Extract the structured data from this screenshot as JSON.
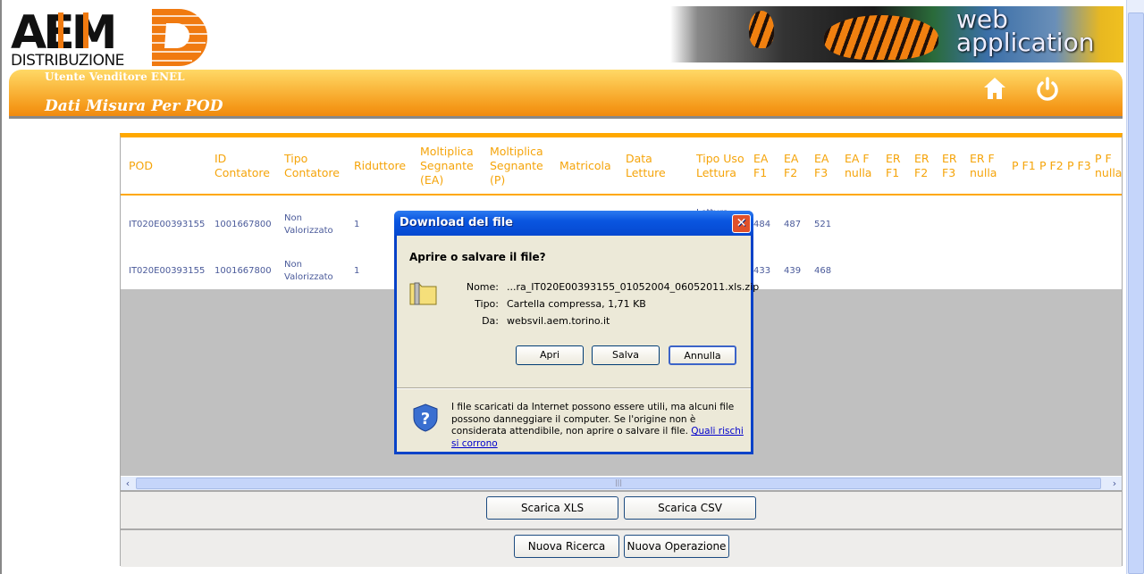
{
  "header": {
    "logo_text": "AEM DISTRIBUZIONE",
    "banner_text_1": "web",
    "banner_text_2": "application",
    "user": "Utente Venditore ENEL",
    "title": "Dati Misura Per POD",
    "icons": [
      "home-icon",
      "power-icon"
    ]
  },
  "table": {
    "columns": [
      "POD",
      "ID Contatore",
      "Tipo Contatore",
      "Riduttore",
      "Moltiplica Segnante (EA)",
      "Moltiplica Segnante (P)",
      "Matricola",
      "Data Letture",
      "Tipo Uso Lettura",
      "EA F1",
      "EA F2",
      "EA F3",
      "EA F nulla",
      "ER F1",
      "ER F2",
      "ER F3",
      "ER F nulla",
      "P F1",
      "P F2",
      "P F3",
      "P F nulla"
    ],
    "rows": [
      [
        "IT020E00393155",
        "1001667800",
        "Non Valorizzato",
        "1",
        "",
        "",
        "",
        "",
        "Lettura",
        "484",
        "487",
        "521",
        "",
        "",
        "",
        "",
        "",
        "",
        "",
        "",
        ""
      ],
      [
        "IT020E00393155",
        "1001667800",
        "Non Valorizzato",
        "1",
        "",
        "",
        "",
        "",
        "",
        "433",
        "439",
        "468",
        "",
        "",
        "",
        "",
        "",
        "",
        "",
        "",
        ""
      ]
    ]
  },
  "buttons": {
    "xls": "Scarica XLS",
    "csv": "Scarica CSV",
    "new_search": "Nuova Ricerca",
    "new_op": "Nuova Operazione"
  },
  "dialog": {
    "title": "Download del file",
    "question": "Aprire o salvare il file?",
    "name_label": "Nome:",
    "name": "...ra_IT020E00393155_01052004_06052011.xls.zip",
    "type_label": "Tipo:",
    "type": "Cartella compressa, 1,71 KB",
    "from_label": "Da:",
    "from": "websvil.aem.torino.it",
    "open": "Apri",
    "save": "Salva",
    "cancel": "Annulla",
    "warning": "I file scaricati da Internet possono essere utili, ma alcuni file possono danneggiare il computer. Se l'origine non è considerata attendibile, non aprire o salvare il file.",
    "link": "Quali rischi si corrono"
  },
  "colors": {
    "accent": "#f5a40a",
    "link": "#0000cc",
    "titlebar": "#0a56e0"
  }
}
